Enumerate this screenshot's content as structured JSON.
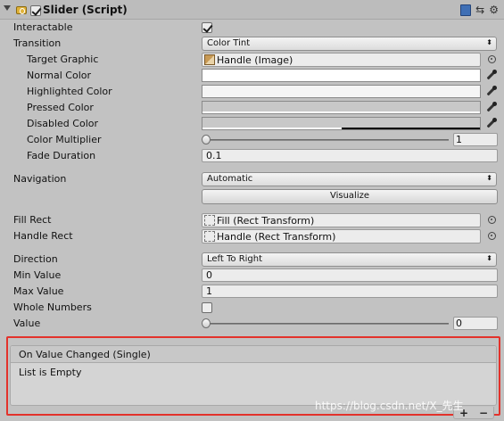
{
  "component": {
    "title": "Slider (Script)",
    "enabled": true,
    "icons": [
      "help-book-icon",
      "preset-icon",
      "settings-gear-icon"
    ]
  },
  "fields": {
    "interactable": {
      "label": "Interactable",
      "checked": true
    },
    "transition": {
      "label": "Transition",
      "value": "Color Tint"
    },
    "target_graphic": {
      "label": "Target Graphic",
      "value": "Handle (Image)"
    },
    "normal_color": {
      "label": "Normal Color",
      "color": "#ffffff"
    },
    "highlighted_color": {
      "label": "Highlighted Color",
      "color": "#f5f5f5"
    },
    "pressed_color": {
      "label": "Pressed Color",
      "color": "#c8c8c8"
    },
    "disabled_color": {
      "label": "Disabled Color",
      "color": "#c8c8c8",
      "alpha": 0.5
    },
    "color_multiplier": {
      "label": "Color Multiplier",
      "value": "1",
      "slider_fraction": 0.0
    },
    "fade_duration": {
      "label": "Fade Duration",
      "value": "0.1"
    },
    "navigation": {
      "label": "Navigation",
      "value": "Automatic"
    },
    "visualize": {
      "label": "Visualize"
    },
    "fill_rect": {
      "label": "Fill Rect",
      "value": "Fill (Rect Transform)"
    },
    "handle_rect": {
      "label": "Handle Rect",
      "value": "Handle (Rect Transform)"
    },
    "direction": {
      "label": "Direction",
      "value": "Left To Right"
    },
    "min_value": {
      "label": "Min Value",
      "value": "0"
    },
    "max_value": {
      "label": "Max Value",
      "value": "1"
    },
    "whole_numbers": {
      "label": "Whole Numbers",
      "checked": false
    },
    "value": {
      "label": "Value",
      "value": "0",
      "slider_fraction": 0.0
    }
  },
  "event": {
    "header": "On Value Changed (Single)",
    "body": "List is Empty",
    "add_label": "+",
    "remove_label": "−"
  },
  "watermark": "https://blog.csdn.net/X_先生",
  "colors": {
    "highlight_border": "#e3322b",
    "panel_bg": "#c2c2c2"
  }
}
